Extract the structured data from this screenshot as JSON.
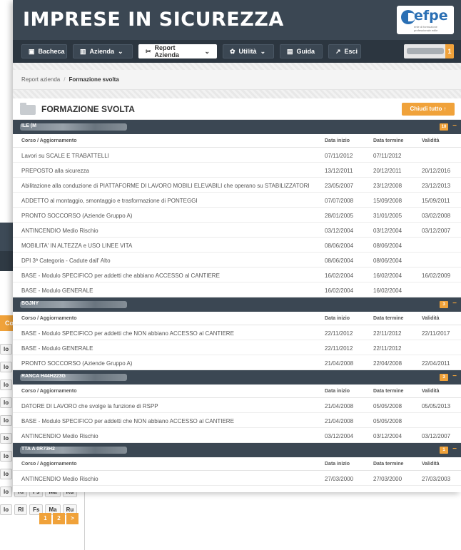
{
  "app": {
    "title": "IMPRESE IN SICUREZZA",
    "logo_text": "efpe",
    "logo_sub": "ente di formazione professionale edile"
  },
  "nav": {
    "items": [
      {
        "label": "Bacheca",
        "icon": "dashboard-icon",
        "glyph": "▣"
      },
      {
        "label": "Azienda",
        "icon": "building-icon",
        "glyph": "▥",
        "dropdown": true
      },
      {
        "label": "Report Azienda",
        "icon": "pin-icon",
        "glyph": "✂",
        "dropdown": true,
        "active": true
      },
      {
        "label": "Utilità",
        "icon": "gear-icon",
        "glyph": "✿",
        "dropdown": true
      },
      {
        "label": "Guida",
        "icon": "book-icon",
        "glyph": "▤"
      },
      {
        "label": "Esci",
        "icon": "exit-icon",
        "glyph": "↗"
      }
    ],
    "user_badge": "1"
  },
  "breadcrumb": {
    "parent": "Report azienda",
    "separator": "/",
    "current": "Formazione svolta"
  },
  "section": {
    "title": "FORMAZIONE SVOLTA",
    "close_all": "Chiudi tutto ↑"
  },
  "columns": {
    "course": "Corso / Aggiornamento",
    "start": "Data inizio",
    "end": "Data termine",
    "validity": "Validità"
  },
  "groups": [
    {
      "name_visible": "ILE (M",
      "badge": "10",
      "rows": [
        {
          "course": "Lavori su SCALE E TRABATTELLI",
          "start": "07/11/2012",
          "end": "07/11/2012",
          "validity": ""
        },
        {
          "course": "PREPOSTO alla sicurezza",
          "start": "13/12/2011",
          "end": "20/12/2011",
          "validity": "20/12/2016"
        },
        {
          "course": "Abilitazione alla conduzione di PIATTAFORME DI LAVORO MOBILI ELEVABILI che operano su STABILIZZATORI",
          "start": "23/05/2007",
          "end": "23/12/2008",
          "validity": "23/12/2013"
        },
        {
          "course": "ADDETTO al montaggio, smontaggio e trasformazione di PONTEGGI",
          "start": "07/07/2008",
          "end": "15/09/2008",
          "validity": "15/09/2011"
        },
        {
          "course": "PRONTO SOCCORSO (Aziende Gruppo A)",
          "start": "28/01/2005",
          "end": "31/01/2005",
          "validity": "03/02/2008"
        },
        {
          "course": "ANTINCENDIO Medio Rischio",
          "start": "03/12/2004",
          "end": "03/12/2004",
          "validity": "03/12/2007"
        },
        {
          "course": "MOBILITA' IN ALTEZZA e USO LINEE VITA",
          "start": "08/06/2004",
          "end": "08/06/2004",
          "validity": ""
        },
        {
          "course": "DPI 3ª Categoria - Cadute dall' Alto",
          "start": "08/06/2004",
          "end": "08/06/2004",
          "validity": ""
        },
        {
          "course": "BASE - Modulo SPECIFICO per addetti che abbiano ACCESSO al CANTIERE",
          "start": "16/02/2004",
          "end": "16/02/2004",
          "validity": "16/02/2009"
        },
        {
          "course": "BASE - Modulo GENERALE",
          "start": "16/02/2004",
          "end": "16/02/2004",
          "validity": ""
        }
      ]
    },
    {
      "name_visible": "BGJNY",
      "badge": "3",
      "rows": [
        {
          "course": "BASE - Modulo SPECIFICO per addetti che NON abbiano ACCESSO al CANTIERE",
          "start": "22/11/2012",
          "end": "22/11/2012",
          "validity": "22/11/2017"
        },
        {
          "course": "BASE - Modulo GENERALE",
          "start": "22/11/2012",
          "end": "22/11/2012",
          "validity": ""
        },
        {
          "course": "PRONTO SOCCORSO (Aziende Gruppo A)",
          "start": "21/04/2008",
          "end": "22/04/2008",
          "validity": "22/04/2011"
        }
      ]
    },
    {
      "name_visible": "RANCA H44H223G",
      "badge": "3",
      "rows": [
        {
          "course": "DATORE DI LAVORO che svolge la funzione di RSPP",
          "start": "21/04/2008",
          "end": "05/05/2008",
          "validity": "05/05/2013"
        },
        {
          "course": "BASE - Modulo SPECIFICO per addetti che NON abbiano ACCESSO al CANTIERE",
          "start": "21/04/2008",
          "end": "05/05/2008",
          "validity": ""
        },
        {
          "course": "ANTINCENDIO Medio Rischio",
          "start": "03/12/2004",
          "end": "03/12/2004",
          "validity": "03/12/2007"
        }
      ]
    },
    {
      "name_visible": "TTA A 0R73H2",
      "badge": "1",
      "rows": [
        {
          "course": "ANTINCENDIO Medio Rischio",
          "start": "27/03/2000",
          "end": "27/03/2000",
          "validity": "27/03/2003"
        }
      ]
    }
  ],
  "background_window": {
    "partial_button": "Co",
    "row_labels": [
      "lo",
      "lo",
      "lo",
      "lo",
      "lo",
      "lo",
      "lo",
      "lo",
      "lo",
      "lo"
    ],
    "action_buttons": [
      "Rl",
      "Fs",
      "Ma",
      "Ru"
    ],
    "pager": [
      "1",
      "2",
      ">"
    ]
  }
}
